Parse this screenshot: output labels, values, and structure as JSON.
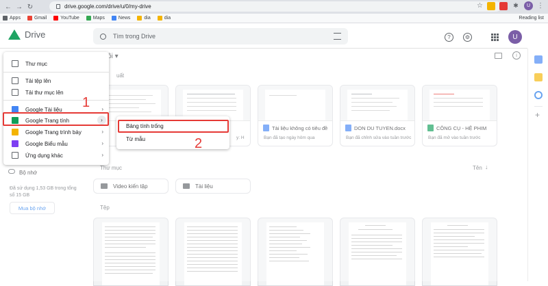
{
  "browser": {
    "url": "drive.google.com/drive/u/0/my-drive",
    "bookmarks": [
      "Apps",
      "Gmail",
      "YouTube",
      "Maps",
      "News",
      "dia",
      "dia"
    ],
    "reading_list": "Reading list",
    "profile_initial": "U"
  },
  "header": {
    "app_name": "Drive",
    "search_placeholder": "Tìm trong Drive",
    "profile_initial": "U"
  },
  "main": {
    "breadcrumb": "a tôi ▾",
    "suggested_label": "uất",
    "files_suggested": [
      {
        "title": "",
        "sub": "",
        "color": "#ffffff"
      },
      {
        "title": "",
        "sub": "y: H",
        "color": "#ffffff"
      },
      {
        "title": "Tài liệu không có tiêu đề",
        "sub": "Bạn đã tạo ngày hôm qua",
        "color": "#4285f4"
      },
      {
        "title": "DON DU TUYEN.docx",
        "sub": "Bạn đã chỉnh sửa vào tuần trước",
        "color": "#4285f4"
      },
      {
        "title": "CÔNG CỤ - HỆ PHIM",
        "sub": "Bạn đã mở vào tuần trước",
        "color": "#0f9d58"
      }
    ],
    "folders_label": "Thư mục",
    "sort_label": "Tên",
    "folders": [
      "Video kiến tập",
      "Tài liệu"
    ],
    "files_label": "Tệp"
  },
  "leftnav": {
    "storage_label": "Bộ nhớ",
    "storage_text": "Đã sử dụng 1,53 GB trong tổng số 15 GB",
    "buy_button": "Mua bộ nhớ"
  },
  "new_menu": {
    "items": [
      {
        "label": "Thư mục",
        "color": "#5f6368",
        "chevron": false
      },
      {
        "label": "Tải tệp lên",
        "color": "#5f6368",
        "chevron": false
      },
      {
        "label": "Tải thư mục lên",
        "color": "#5f6368",
        "chevron": false
      },
      {
        "label": "Google Tài liệu",
        "color": "#4285f4",
        "chevron": true
      },
      {
        "label": "Google Trang tính",
        "color": "#0f9d58",
        "chevron": true
      },
      {
        "label": "Google Trang trình bày",
        "color": "#f4b400",
        "chevron": true
      },
      {
        "label": "Google Biểu mẫu",
        "color": "#7e3ff2",
        "chevron": true
      },
      {
        "label": "Ứng dụng khác",
        "color": "#5f6368",
        "chevron": true
      }
    ]
  },
  "submenu": {
    "items": [
      "Bảng tính trống",
      "Từ mẫu"
    ]
  },
  "annotations": {
    "step1": "1",
    "step2": "2"
  },
  "colors": {
    "accent_red": "#e53935",
    "drive_green": "#1fa463",
    "link_blue": "#1a73e8"
  }
}
